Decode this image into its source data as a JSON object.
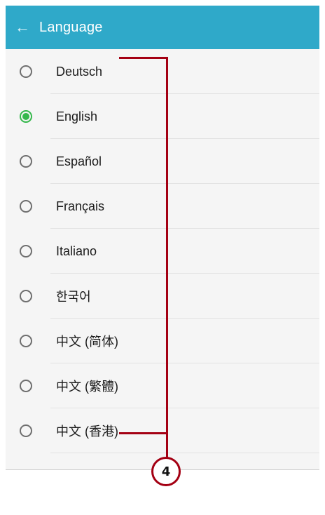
{
  "header": {
    "back_icon": "arrow-left-icon",
    "title": "Language"
  },
  "languages": [
    {
      "label": "Deutsch",
      "selected": false
    },
    {
      "label": "English",
      "selected": true
    },
    {
      "label": "Español",
      "selected": false
    },
    {
      "label": "Français",
      "selected": false
    },
    {
      "label": "Italiano",
      "selected": false
    },
    {
      "label": "한국어",
      "selected": false
    },
    {
      "label": "中文 (简体)",
      "selected": false
    },
    {
      "label": "中文 (繁體)",
      "selected": false
    },
    {
      "label": "中文 (香港)",
      "selected": false
    }
  ],
  "callout": {
    "number": "4",
    "color": "#a40013"
  },
  "colors": {
    "appbar": "#2fa9c9",
    "radio_selected": "#35b84c"
  }
}
